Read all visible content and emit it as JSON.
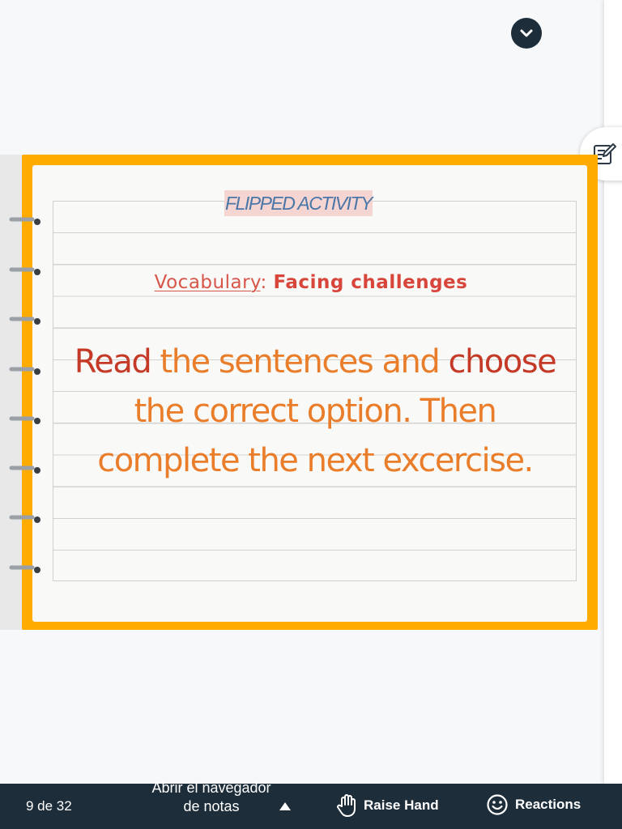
{
  "slide": {
    "tag": "FLIPPED ACTIVITY",
    "vocab_label": "Vocabulary",
    "vocab_colon": ":",
    "vocab_topic": "Facing challenges",
    "instructions": {
      "part1": "Read",
      "part2": " the sentences and ",
      "part3": "choose",
      "part4": " the correct option. Then complete the next excercise."
    }
  },
  "toolbar": {
    "page_counter": "9 de 32",
    "notes_browser_label": "Abrir el navegador de notas",
    "raise_hand_label": "Raise Hand",
    "reactions_label": "Reactions"
  },
  "icons": {
    "collapse": "chevron-down-icon",
    "notes": "notes-edit-icon",
    "caret": "caret-up-icon",
    "hand": "hand-icon",
    "smile": "smile-icon"
  },
  "colors": {
    "frame": "#ffab00",
    "bar": "#1d2d3a",
    "accent_red": "#c43a26",
    "accent_orange": "#ea7d2a"
  }
}
